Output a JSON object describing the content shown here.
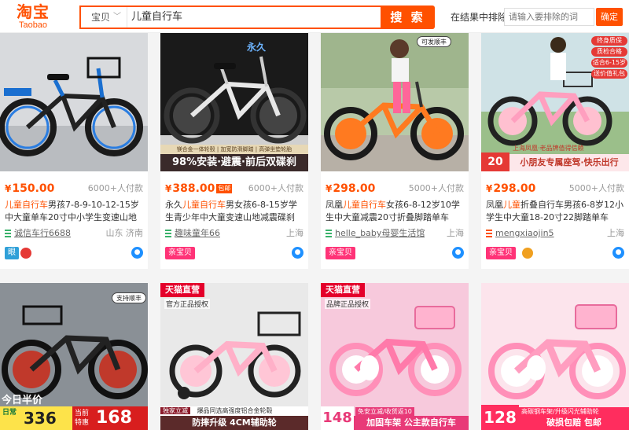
{
  "header": {
    "logo_cn": "淘宝",
    "logo_en": "Taobao",
    "search_scope": "宝贝",
    "search_query": "儿童自行车",
    "search_button": "搜 索",
    "exclude_label": "在结果中排除",
    "exclude_placeholder": "请输入要排除的词",
    "confirm_button": "确定"
  },
  "products": [
    {
      "price_yen": "¥",
      "price": "150.00",
      "pay_count": "6000+人付款",
      "title_hl": "儿童自行车",
      "title_rest": "男孩7-8-9-10-12-15岁中大童单车20寸中小学生变速山地",
      "shop": "诚信车行6688",
      "location": "山东 济南",
      "tag": "眼"
    },
    {
      "price_yen": "¥",
      "price": "388.00",
      "badge": "包邮",
      "pay_count": "6000+人付款",
      "title_pre": "永久",
      "title_hl": "儿童自行车",
      "title_rest": "男女孩6-8-15岁学生青少年中大童变速山地减震碟刹",
      "shop": "趣味童年66",
      "location": "上海",
      "tag": "亲宝贝",
      "img_banner_small": "镁合金一体轮毂 | 加宽防滑脚踏 | 高弹坐垫轮胎",
      "img_banner": "98%安装·避震·前后双碟刹"
    },
    {
      "price_yen": "¥",
      "price": "298.00",
      "pay_count": "5000+人付款",
      "title_pre": "凤凰",
      "title_hl": "儿童自行车",
      "title_rest": "女孩6-8-12岁10学生中大童减震20寸折叠脚踏单车",
      "shop": "helle_baby母婴生活馆",
      "location": "上海",
      "tag": "亲宝贝",
      "img_badge": "可发顺丰"
    },
    {
      "price_yen": "¥",
      "price": "298.00",
      "pay_count": "5000+人付款",
      "title_pre": "凤凰",
      "title_hl": "儿童",
      "title_rest": "折叠自行车男孩6-8岁12小学生中大童18-20寸22脚踏单车",
      "shop": "mengxiaojin5",
      "location": "上海",
      "tag": "亲宝贝",
      "img_side_tags": [
        "终身质保",
        "质检合格",
        "适合6-15岁",
        "送价值礼包"
      ],
      "img_price_small": "20",
      "img_strip": "小朋友专属座驾·快乐出行",
      "img_strip_small": "上海凤凰·老品牌值得信赖"
    }
  ],
  "bottom_products": [
    {
      "sale_text": "今日半价",
      "daily": "日常",
      "current": "当前",
      "special": "特惠",
      "old_price": "336",
      "new_price": "168",
      "sf": "支持顺丰"
    },
    {
      "tmall": "天猫直营",
      "official": "官方正品授权",
      "strip": "防摔升级 4CM辅助轮",
      "small": "爆品同选高强度铝合金轮毂",
      "brand_small": "独家立减"
    },
    {
      "tmall": "天猫直营",
      "official": "品牌正品授权",
      "strip": "加固车架 公主款自行车",
      "price": "148",
      "small": "免安立减/收货返10"
    },
    {
      "price": "128",
      "strip": "破损包赔 包邮",
      "small": "高碳钢车架/升级闪光辅助轮"
    }
  ],
  "colors": {
    "brand": "#ff5000",
    "tag_pink": "#ff3377"
  }
}
